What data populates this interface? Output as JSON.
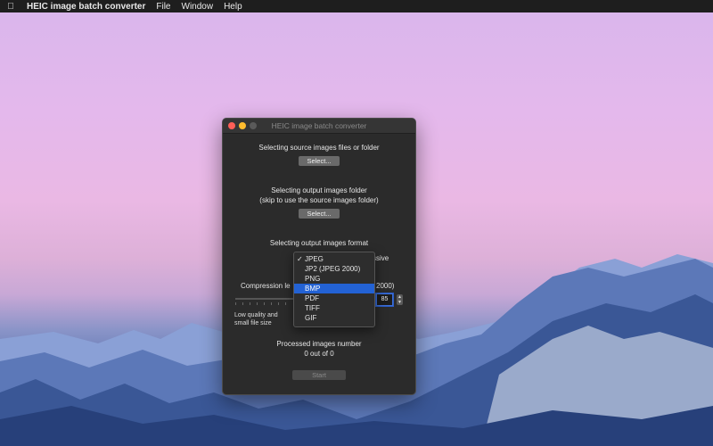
{
  "menubar": {
    "app_name": "HEIC image batch converter",
    "items": [
      "File",
      "Window",
      "Help"
    ]
  },
  "window": {
    "title": "HEIC image batch converter",
    "source": {
      "label": "Selecting source images files or folder",
      "button": "Select..."
    },
    "output_folder": {
      "label": "Selecting output images folder",
      "sublabel": "(skip to use the source images folder)",
      "button": "Select..."
    },
    "format": {
      "label": "Selecting output images format",
      "progressive_partial": "ssive",
      "selected": "JPEG"
    },
    "compression": {
      "label_partial": "Compression le",
      "suffix_partial": "2000)",
      "value": "85"
    },
    "quality_low_line1": "Low quality and",
    "quality_low_line2": "small file size",
    "processed": {
      "label": "Processed images number",
      "value": "0 out of 0"
    },
    "start_button": "Start"
  },
  "format_options": [
    {
      "label": "JPEG",
      "checked": true
    },
    {
      "label": "JP2 (JPEG 2000)"
    },
    {
      "label": "PNG"
    },
    {
      "label": "BMP",
      "highlighted": true
    },
    {
      "label": "PDF"
    },
    {
      "label": "TIFF"
    },
    {
      "label": "GIF"
    }
  ],
  "colors": {
    "accent": "#2362d4",
    "window_bg": "#2b2b2b"
  }
}
